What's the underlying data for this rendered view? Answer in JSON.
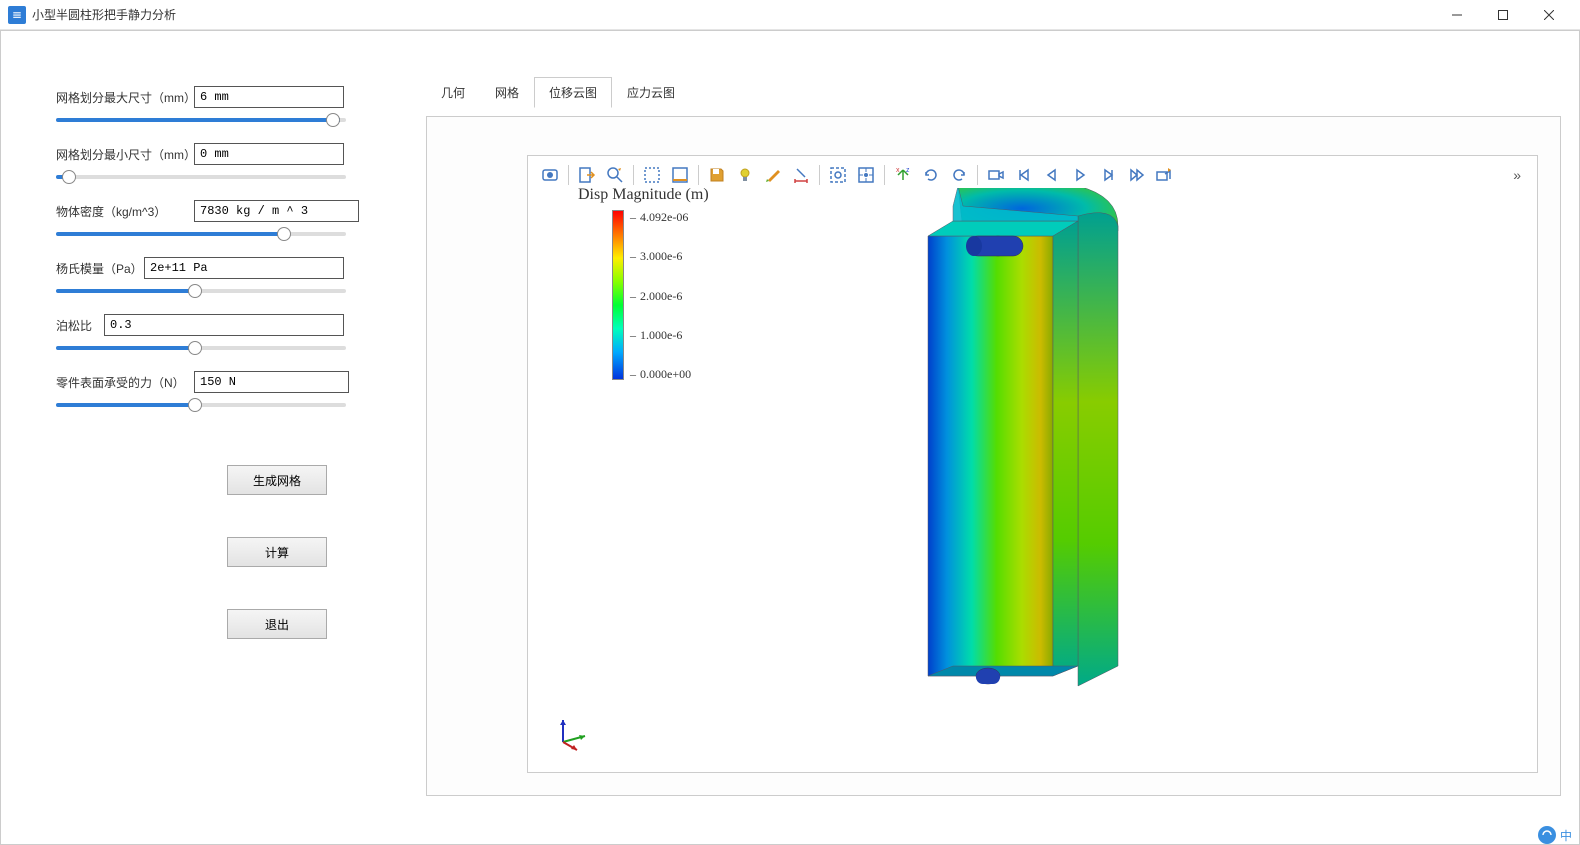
{
  "window": {
    "title": "小型半圆柱形把手静力分析"
  },
  "params": {
    "max_mesh": {
      "label": "网格划分最大尺寸（mm）",
      "value": "6 mm"
    },
    "min_mesh": {
      "label": "网格划分最小尺寸（mm）",
      "value": "0 mm"
    },
    "density": {
      "label": "物体密度（kg/m^3）",
      "value": "7830 kg / m ^ 3"
    },
    "youngs": {
      "label": "杨氏模量（Pa）",
      "value": "2e+11 Pa"
    },
    "poisson": {
      "label": "泊松比",
      "value": "0.3"
    },
    "force": {
      "label": "零件表面承受的力（N）",
      "value": "150 N"
    }
  },
  "buttons": {
    "generate_mesh": "生成网格",
    "calculate": "计算",
    "exit": "退出"
  },
  "tabs": {
    "geometry": "几何",
    "mesh": "网格",
    "displacement": "位移云图",
    "stress": "应力云图"
  },
  "toolbar_icons": {
    "screenshot": "screenshot",
    "export": "export",
    "zoom": "zoom-fit",
    "select_box": "select-box",
    "select_region": "select-region",
    "save_view": "save-view",
    "light": "light",
    "brush": "brush",
    "dimension": "dimension",
    "fit": "fit-window",
    "target": "target",
    "rotate_axis": "rotate-axis",
    "rotate_ccw": "rotate-ccw",
    "rotate_cw": "rotate-cw",
    "camera": "camera",
    "first": "first",
    "prev": "prev",
    "play": "play",
    "next": "next",
    "last": "last",
    "export_anim": "export-anim"
  },
  "legend": {
    "title": "Disp Magnitude (m)",
    "ticks": [
      "4.092e-06",
      "3.000e-6",
      "2.000e-6",
      "1.000e-6",
      "0.000e+00"
    ]
  },
  "ime": {
    "char": "中"
  }
}
